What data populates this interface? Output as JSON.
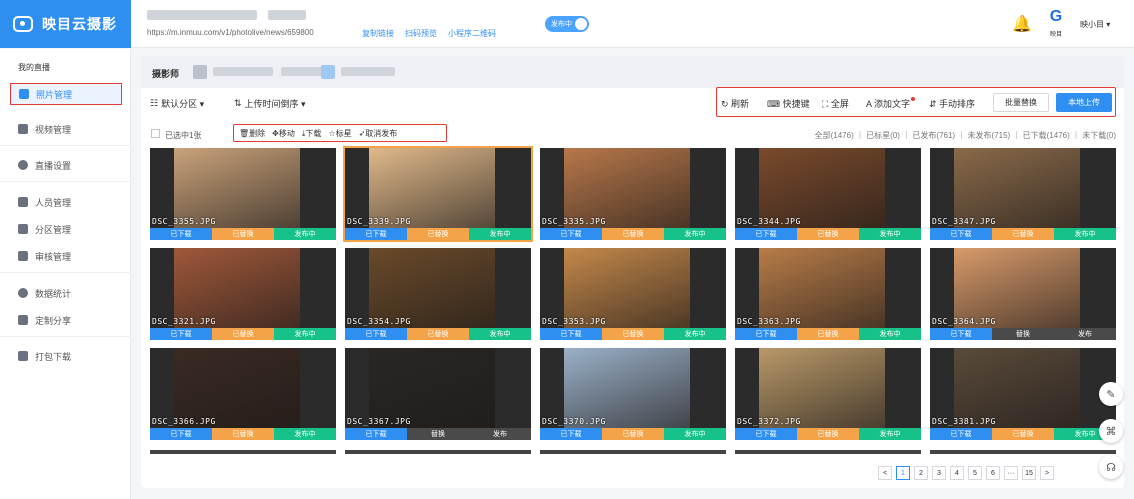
{
  "app": {
    "logo_text": "映目云摄影"
  },
  "header": {
    "url": "https://m.inmuu.com/v1/photolive/news/659800",
    "links": [
      "复制链接",
      "扫码预览",
      "小程序二维码"
    ],
    "publish_toggle": "发布中",
    "brand_label": "映目",
    "user_name": "映小目 ▾"
  },
  "sidebar": {
    "heading": "我的直播",
    "items": [
      {
        "label": "照片管理",
        "icon": "image-icon",
        "active": true
      },
      {
        "label": "视频管理",
        "icon": "video-icon"
      },
      {
        "label": "直播设置",
        "icon": "settings-icon"
      },
      {
        "label": "人员管理",
        "icon": "person-icon"
      },
      {
        "label": "分区管理",
        "icon": "grid-icon"
      },
      {
        "label": "审核管理",
        "icon": "review-icon"
      },
      {
        "label": "数据统计",
        "icon": "chart-icon"
      },
      {
        "label": "定制分享",
        "icon": "share-icon"
      },
      {
        "label": "打包下载",
        "icon": "download-icon"
      }
    ]
  },
  "main": {
    "photographer_label": "摄影师",
    "filter_zone": "默认分区 ▾",
    "filter_sort": "上传时间倒序 ▾",
    "tools": [
      "刷新",
      "快捷键",
      "全屏",
      "添加文字",
      "手动排序"
    ],
    "batch_replace": "批量替换",
    "local_upload": "本地上传",
    "selected_text": "已选中1张",
    "actions": [
      "删除",
      "移动",
      "下载",
      "标星",
      "取消发布"
    ],
    "stats": "全部(1476) ｜ 已标星(0) ｜ 已发布(761) ｜ 未发布(715) ｜ 已下载(1476) ｜ 未下载(0)"
  },
  "photos": [
    {
      "name": "DSC_3355.JPG",
      "s": [
        "已下载",
        "已替换",
        "发布中"
      ],
      "c": [
        "blue",
        "orange",
        "green"
      ],
      "tint": "#c9a27a"
    },
    {
      "name": "DSC_3339.JPG",
      "s": [
        "已下载",
        "已替换",
        "发布中"
      ],
      "c": [
        "blue",
        "orange",
        "green"
      ],
      "tint": "#e0b98a",
      "hl": true
    },
    {
      "name": "DSC_3335.JPG",
      "s": [
        "已下载",
        "已替换",
        "发布中"
      ],
      "c": [
        "blue",
        "orange",
        "green"
      ],
      "tint": "#b8784a"
    },
    {
      "name": "DSC_3344.JPG",
      "s": [
        "已下载",
        "已替换",
        "发布中"
      ],
      "c": [
        "blue",
        "orange",
        "green"
      ],
      "tint": "#7a4a2c"
    },
    {
      "name": "DSC_3347.JPG",
      "s": [
        "已下载",
        "已替换",
        "发布中"
      ],
      "c": [
        "blue",
        "orange",
        "green"
      ],
      "tint": "#8a6a4a"
    },
    {
      "name": "DSC_3321.JPG",
      "s": [
        "已下载",
        "已替换",
        "发布中"
      ],
      "c": [
        "blue",
        "orange",
        "green"
      ],
      "tint": "#a0583a"
    },
    {
      "name": "DSC_3354.JPG",
      "s": [
        "已下载",
        "已替换",
        "发布中"
      ],
      "c": [
        "blue",
        "orange",
        "green"
      ],
      "tint": "#6a4a2a"
    },
    {
      "name": "DSC_3353.JPG",
      "s": [
        "已下载",
        "已替换",
        "发布中"
      ],
      "c": [
        "blue",
        "orange",
        "green"
      ],
      "tint": "#c4884a"
    },
    {
      "name": "DSC_3363.JPG",
      "s": [
        "已下载",
        "已替换",
        "发布中"
      ],
      "c": [
        "blue",
        "orange",
        "green"
      ],
      "tint": "#b87c48"
    },
    {
      "name": "DSC_3364.JPG",
      "s": [
        "已下载",
        "替换",
        "发布"
      ],
      "c": [
        "blue",
        "dark",
        "dark"
      ],
      "tint": "#d89a6a"
    },
    {
      "name": "DSC_3366.JPG",
      "s": [
        "已下载",
        "已替换",
        "发布中"
      ],
      "c": [
        "blue",
        "orange",
        "green"
      ],
      "tint": "#3a2a22"
    },
    {
      "name": "DSC_3367.JPG",
      "s": [
        "已下载",
        "替换",
        "发布"
      ],
      "c": [
        "blue",
        "dark",
        "dark"
      ],
      "tint": "#2a2624"
    },
    {
      "name": "DSC_3370.JPG",
      "s": [
        "已下载",
        "已替换",
        "发布中"
      ],
      "c": [
        "blue",
        "orange",
        "green"
      ],
      "tint": "#9ab0c8"
    },
    {
      "name": "DSC_3372.JPG",
      "s": [
        "已下载",
        "已替换",
        "发布中"
      ],
      "c": [
        "blue",
        "orange",
        "green"
      ],
      "tint": "#b89868"
    },
    {
      "name": "DSC_3381.JPG",
      "s": [
        "已下载",
        "已替换",
        "发布中"
      ],
      "c": [
        "blue",
        "orange",
        "green"
      ],
      "tint": "#5a4a3a"
    }
  ],
  "pager": [
    "<",
    "1",
    "2",
    "3",
    "4",
    "5",
    "6",
    "···",
    "15",
    ">"
  ],
  "pager_current": "1",
  "colors": {
    "accent": "#2f8ff1",
    "replaced": "#f5a348",
    "published": "#16c28a",
    "inactive": "#4a4a4a",
    "highlight": "#e53935"
  }
}
